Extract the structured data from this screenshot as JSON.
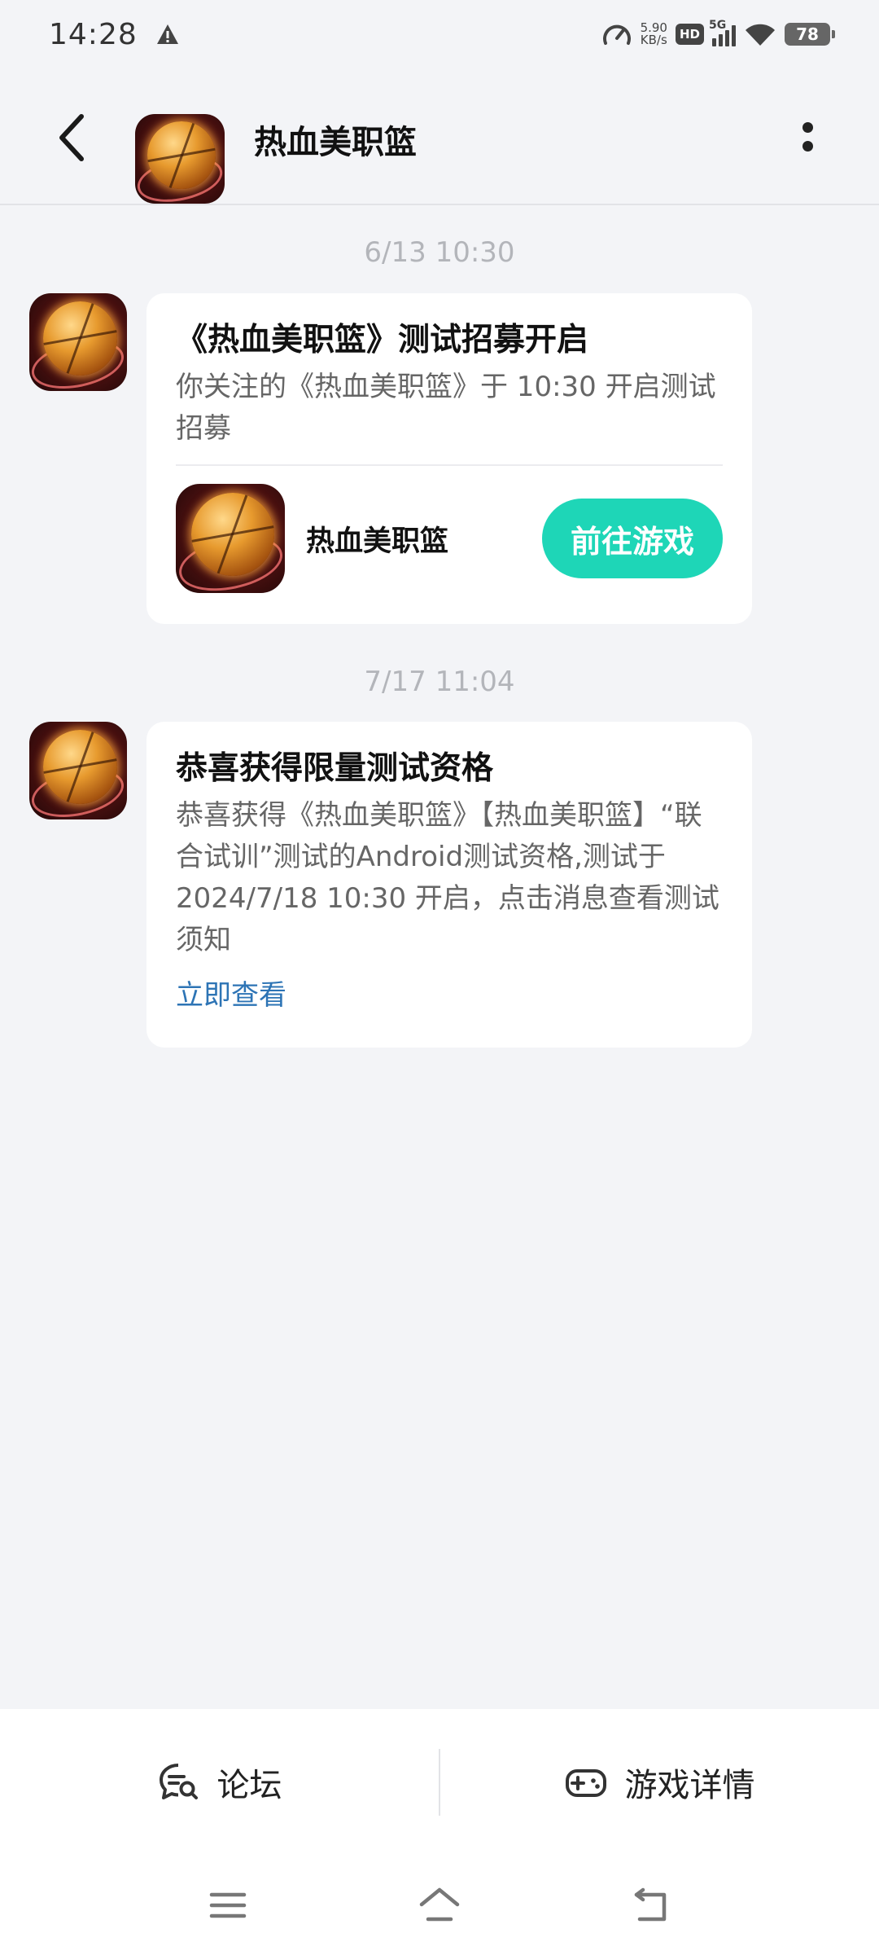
{
  "status_bar": {
    "time": "14:28",
    "net_speed_value": "5.90",
    "net_speed_unit": "KB/s",
    "hd_label": "HD",
    "network_label": "5G",
    "battery": "78"
  },
  "header": {
    "title": "热血美职篮",
    "avatar_icon": "game-logo-icon"
  },
  "messages": [
    {
      "timestamp": "6/13  10:30",
      "title": "《热血美职篮》测试招募开启",
      "body": "你关注的《热血美职篮》于 10:30 开启测试招募",
      "game_name": "热血美职篮",
      "button_label": "前往游戏"
    },
    {
      "timestamp": "7/17  11:04",
      "title": "恭喜获得限量测试资格",
      "body": "恭喜获得《热血美职篮》【热血美职篮】“联合试训”测试的Android测试资格,测试于 2024/7/18 10:30 开启，点击消息查看测试须知",
      "link_label": "立即查看"
    }
  ],
  "bottom_bar": {
    "forum_label": "论坛",
    "details_label": "游戏详情"
  },
  "colors": {
    "accent": "#1ed6b7",
    "link": "#2d74b5",
    "background": "#f3f4f7"
  }
}
